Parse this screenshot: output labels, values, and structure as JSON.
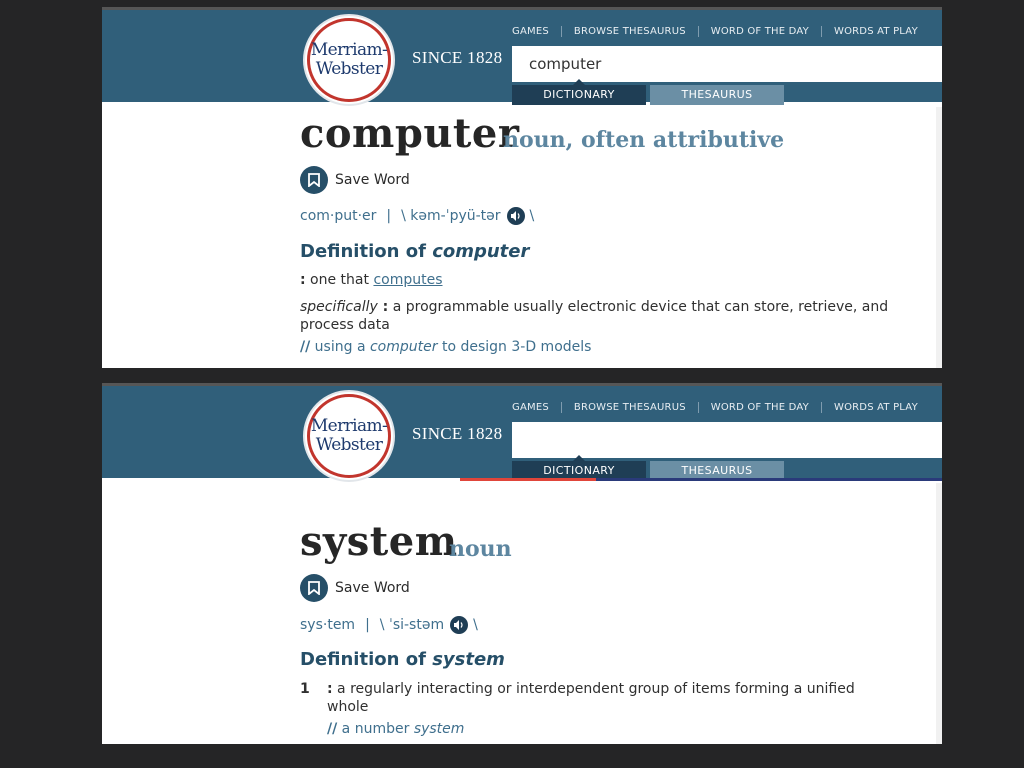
{
  "header": {
    "logo_line1": "Merriam-",
    "logo_line2": "Webster",
    "since": "SINCE 1828",
    "nav": [
      "GAMES",
      "BROWSE THESAURUS",
      "WORD OF THE DAY",
      "WORDS AT PLAY"
    ],
    "tabs": {
      "dictionary": "DICTIONARY",
      "thesaurus": "THESAURUS"
    }
  },
  "entries": [
    {
      "search_value": "computer",
      "headword": "computer",
      "part_of_speech": "noun, often attributive",
      "save_label": "Save Word",
      "syllables": "com·put·er",
      "pron_sep": "|",
      "pron_open": "\\ kəm-ˈpyü-tər",
      "pron_close": "\\",
      "definition_heading": "Definition of",
      "definition_word": "computer",
      "sense1_colon": ":",
      "sense1_text": " one that ",
      "sense1_link": "computes",
      "sense2_prefix": "specifically",
      "sense2_colon": " :",
      "sense2_text": " a programmable usually electronic device that can store, retrieve, and process data",
      "example_mark": "//",
      "example_pre": " using a ",
      "example_word": "computer",
      "example_post": " to design 3-D models"
    },
    {
      "search_value": "",
      "headword": "system",
      "part_of_speech": "noun",
      "save_label": "Save Word",
      "syllables": "sys·tem",
      "pron_sep": "|",
      "pron_open": "\\ ˈsi-stəm",
      "pron_close": "\\",
      "definition_heading": "Definition of",
      "definition_word": "system",
      "sense_number": "1",
      "sense1_colon": ":",
      "sense1_text": " a regularly interacting or interdependent group of items forming a unified whole",
      "example_mark": "//",
      "example_pre": " a number ",
      "example_word": "system"
    }
  ]
}
